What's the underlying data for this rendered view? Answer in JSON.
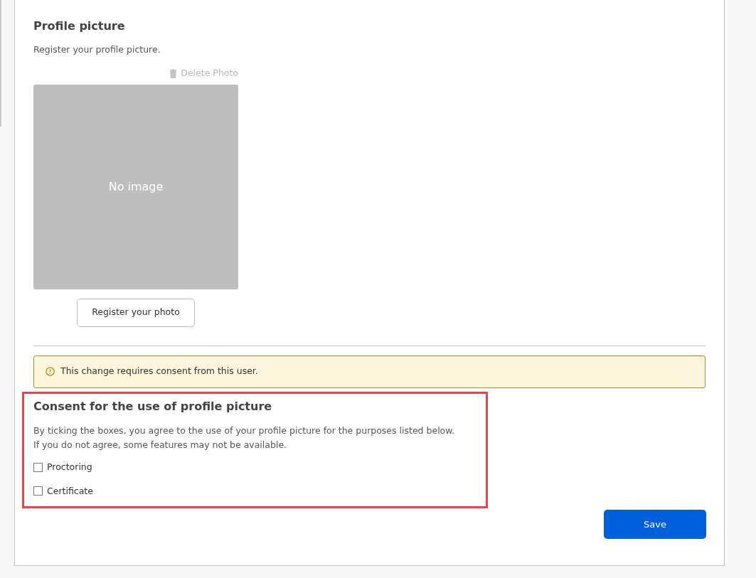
{
  "profile": {
    "title": "Profile picture",
    "description": "Register your profile picture.",
    "delete_label": "Delete Photo",
    "placeholder_text": "No image",
    "register_button": "Register your photo"
  },
  "notice": {
    "text": "This change requires consent from this user."
  },
  "consent": {
    "title": "Consent for the use of profile picture",
    "description": [
      "By ticking the boxes, you agree to the use of your profile picture for the purposes listed below.",
      "If you do not agree, some features may not be available."
    ],
    "options": [
      {
        "label": "Proctoring",
        "checked": false
      },
      {
        "label": "Certificate",
        "checked": false
      }
    ]
  },
  "save_button": "Save"
}
